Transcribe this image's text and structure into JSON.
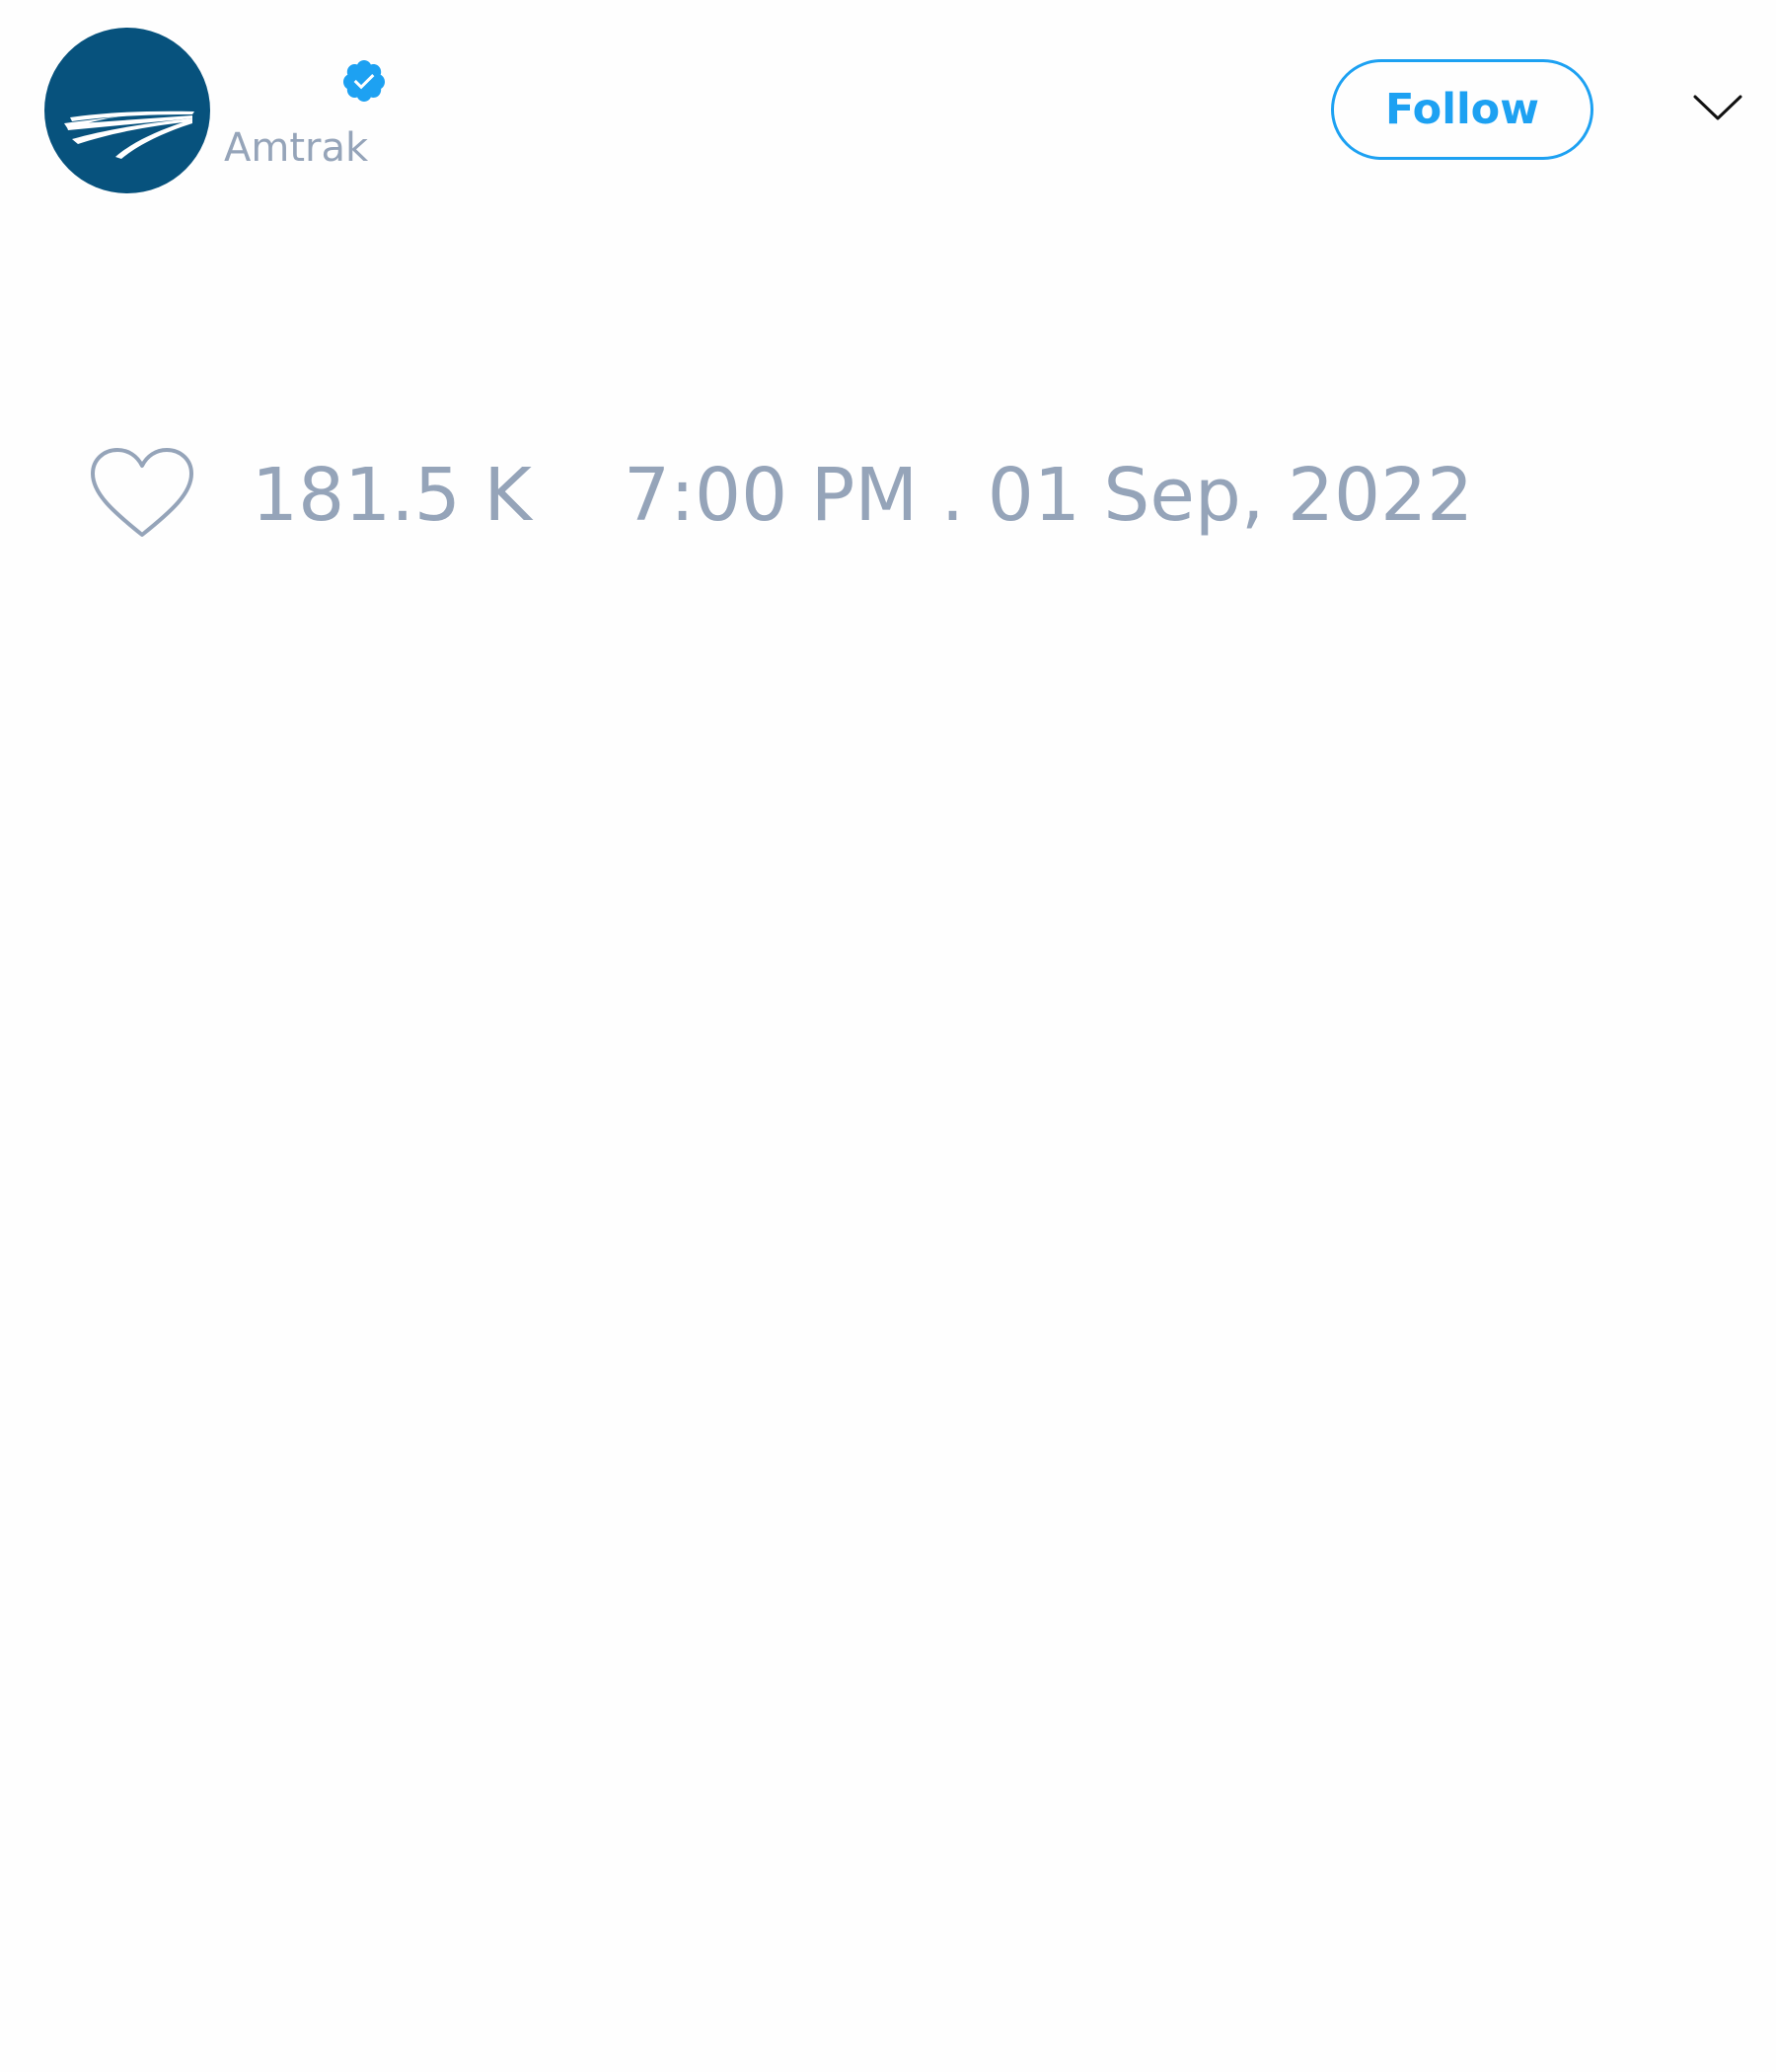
{
  "tweet": {
    "user": {
      "handle": "Amtrak",
      "verified": true,
      "avatar_icon": "amtrak-logo-icon",
      "avatar_color": "#07527d"
    },
    "follow_button": {
      "label": "Follow",
      "color": "#1da1f2"
    },
    "more_menu_icon": "chevron-down-icon",
    "likes": {
      "icon": "heart-outline-icon",
      "count": "181.5 K"
    },
    "timestamp": "7:00 PM . 01 Sep, 2022",
    "muted_text_color": "#95a4b9"
  }
}
